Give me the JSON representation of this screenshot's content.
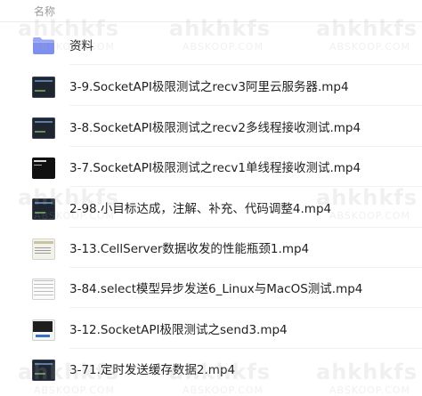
{
  "header": {
    "column_name": "名称"
  },
  "files": [
    {
      "name": "资料",
      "kind": "folder",
      "thumb": "folder-icon"
    },
    {
      "name": "3-9.SocketAPI极限测试之recv3阿里云服务器.mp4",
      "kind": "video",
      "thumb": "thumb-dark"
    },
    {
      "name": "3-8.SocketAPI极限测试之recv2多线程接收测试.mp4",
      "kind": "video",
      "thumb": "thumb-dark"
    },
    {
      "name": "3-7.SocketAPI极限测试之recv1单线程接收测试.mp4",
      "kind": "video",
      "thumb": "thumb-black"
    },
    {
      "name": "2-98.小目标达成，注解、补充、代码调整4.mp4",
      "kind": "video",
      "thumb": "thumb-dark"
    },
    {
      "name": "3-13.CellServer数据收发的性能瓶颈1.mp4",
      "kind": "video",
      "thumb": "thumb-light"
    },
    {
      "name": "3-84.select模型异步发送6_Linux与MacOS测试.mp4",
      "kind": "video",
      "thumb": "thumb-grid"
    },
    {
      "name": "3-12.SocketAPI极限测试之send3.mp4",
      "kind": "video",
      "thumb": "thumb-mixed"
    },
    {
      "name": "3-71.定时发送缓存数据2.mp4",
      "kind": "video",
      "thumb": "thumb-dark"
    }
  ],
  "watermark": {
    "brand": "ahkhkfs",
    "domain": "ABSKOOP.COM"
  },
  "colors": {
    "folder": "#7f8ff0",
    "folder_tab": "#9aa6f5",
    "text": "#1f1f1f",
    "header_text": "#9a9a9a"
  }
}
